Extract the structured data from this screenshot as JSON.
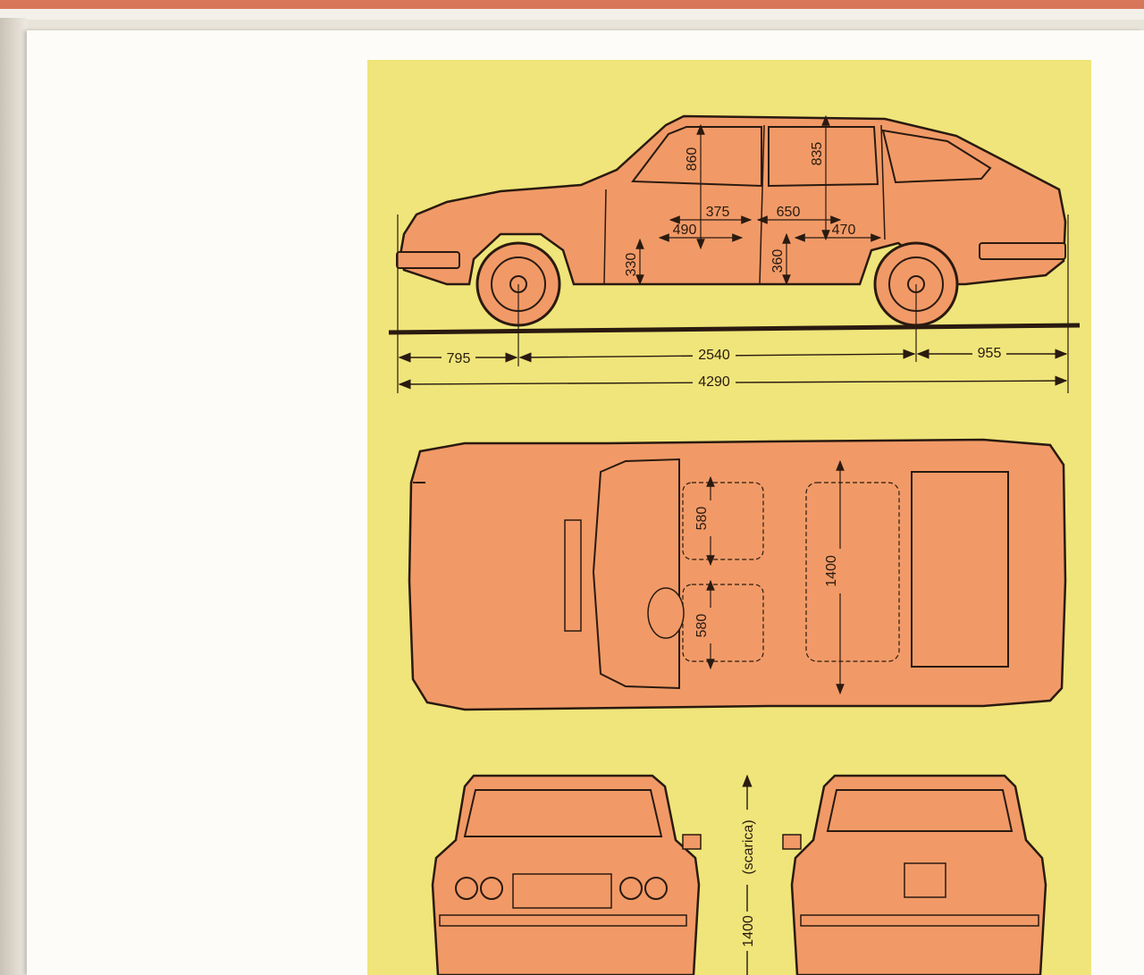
{
  "colors": {
    "plate": "#efe57a",
    "car_body": "#f19a67",
    "ink": "#2a1a10",
    "page": "#fdfcf8"
  },
  "side_view": {
    "dimensions": {
      "front_headroom": "860",
      "rear_headroom": "835",
      "legroom_front_a": "375",
      "legroom_rear": "650",
      "front_seat_depth": "490",
      "rear_seat_depth": "470",
      "front_seat_height": "330",
      "rear_seat_height": "360",
      "front_overhang": "795",
      "wheelbase": "2540",
      "rear_overhang": "955",
      "overall_length": "4290"
    }
  },
  "top_view": {
    "dimensions": {
      "seat_width_upper": "580",
      "seat_width_lower": "580",
      "interior_width": "1400"
    }
  },
  "end_views": {
    "dimensions": {
      "height_label": "(scarica)",
      "height_value": "1400"
    }
  }
}
